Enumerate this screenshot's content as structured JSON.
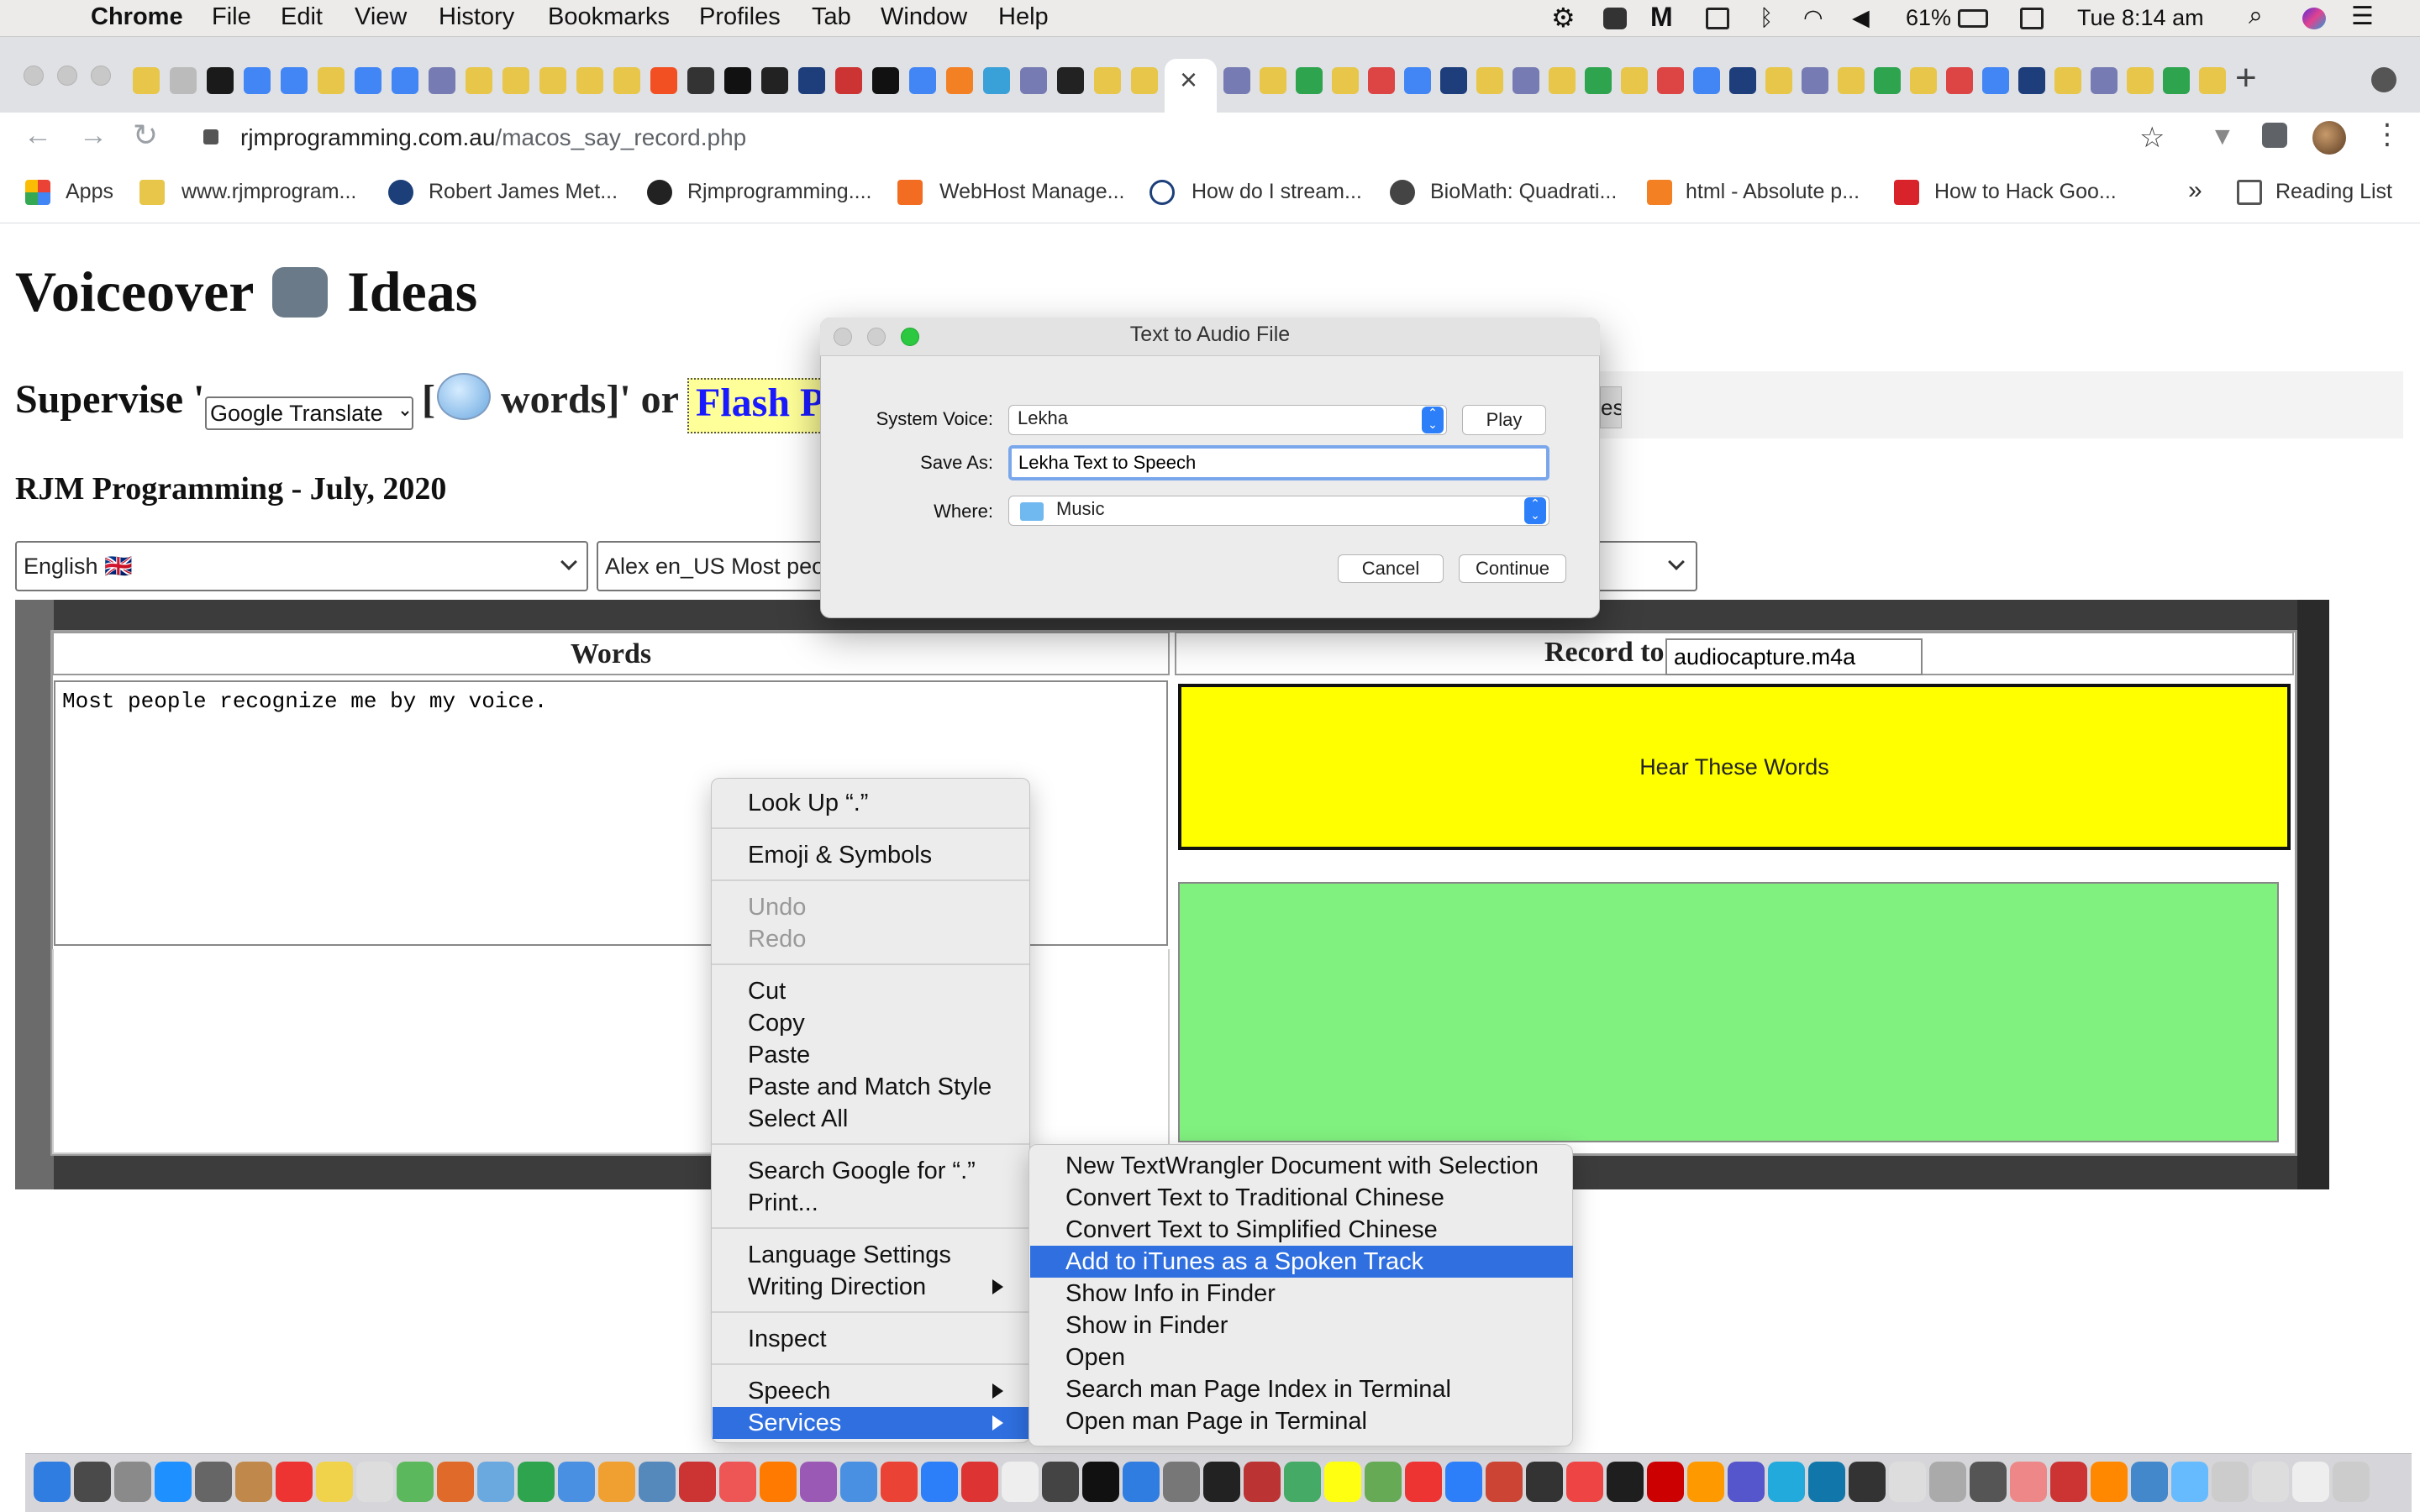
{
  "menubar": {
    "app": "Chrome",
    "items": [
      "File",
      "Edit",
      "View",
      "History",
      "Bookmarks",
      "Profiles",
      "Tab",
      "Window",
      "Help"
    ],
    "battery": "61%",
    "datetime": "Tue 8:14 am"
  },
  "browser": {
    "url_domain": "rjmprogramming.com.au",
    "url_path": "/macos_say_record.php"
  },
  "bookmarks": [
    "Apps",
    "www.rjmprogram...",
    "Robert James Met...",
    "Rjmprogramming....",
    "WebHost Manage...",
    "How do I stream...",
    "BioMath: Quadrati...",
    "html - Absolute p...",
    "How to Hack Goo..."
  ],
  "bookmarks_more": "»",
  "reading_list": "Reading List",
  "page": {
    "title_a": "Voiceover",
    "title_b": "Ideas",
    "supervise_a": "Supervise '",
    "supervise_sel": "Google Translate",
    "supervise_b": "[",
    "supervise_c": "words]' or",
    "flash": "Flash P",
    "es_fragment": "es",
    "subtitle": "RJM Programming - July, 2020",
    "language_select": "English 🇬🇧",
    "voice_select": "Alex en_US Most peo",
    "words_header": "Words",
    "record_label": "Record to",
    "record_file": "audiocapture.m4a",
    "words_text": "Most people recognize me by my voice.",
    "hear_button": "Hear These Words"
  },
  "dialog": {
    "title": "Text to Audio File",
    "system_voice_label": "System Voice:",
    "system_voice_value": "Lekha",
    "play": "Play",
    "save_as_label": "Save As:",
    "save_as_value": "Lekha Text to Speech",
    "where_label": "Where:",
    "where_value": "Music",
    "cancel": "Cancel",
    "continue": "Continue"
  },
  "context_menu": {
    "look_up": "Look Up “.”",
    "emoji": "Emoji & Symbols",
    "undo": "Undo",
    "redo": "Redo",
    "cut": "Cut",
    "copy": "Copy",
    "paste": "Paste",
    "paste_match": "Paste and Match Style",
    "select_all": "Select All",
    "search_google": "Search Google for “.”",
    "print": "Print...",
    "language_settings": "Language Settings",
    "writing_direction": "Writing Direction",
    "inspect": "Inspect",
    "speech": "Speech",
    "services": "Services"
  },
  "services_menu": [
    "New TextWrangler Document with Selection",
    "Convert Text to Traditional Chinese",
    "Convert Text to Simplified Chinese",
    "Add to iTunes as a Spoken Track",
    "Show Info in Finder",
    "Show in Finder",
    "Open",
    "Search man Page Index in Terminal",
    "Open man Page in Terminal"
  ],
  "services_highlight": 3,
  "colors": {
    "menu_highlight": "#2f6fe0",
    "hear_button_bg": "#ffff00",
    "record_area_bg": "#80f07f",
    "flash_link": "#1a1aff"
  }
}
